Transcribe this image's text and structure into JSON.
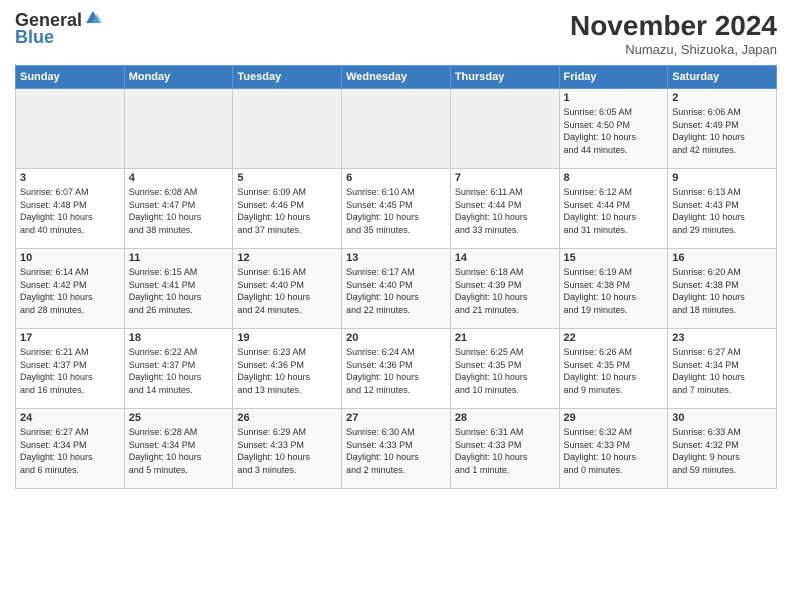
{
  "header": {
    "logo_general": "General",
    "logo_blue": "Blue",
    "title": "November 2024",
    "location": "Numazu, Shizuoka, Japan"
  },
  "weekdays": [
    "Sunday",
    "Monday",
    "Tuesday",
    "Wednesday",
    "Thursday",
    "Friday",
    "Saturday"
  ],
  "weeks": [
    [
      {
        "day": "",
        "info": ""
      },
      {
        "day": "",
        "info": ""
      },
      {
        "day": "",
        "info": ""
      },
      {
        "day": "",
        "info": ""
      },
      {
        "day": "",
        "info": ""
      },
      {
        "day": "1",
        "info": "Sunrise: 6:05 AM\nSunset: 4:50 PM\nDaylight: 10 hours\nand 44 minutes."
      },
      {
        "day": "2",
        "info": "Sunrise: 6:06 AM\nSunset: 4:49 PM\nDaylight: 10 hours\nand 42 minutes."
      }
    ],
    [
      {
        "day": "3",
        "info": "Sunrise: 6:07 AM\nSunset: 4:48 PM\nDaylight: 10 hours\nand 40 minutes."
      },
      {
        "day": "4",
        "info": "Sunrise: 6:08 AM\nSunset: 4:47 PM\nDaylight: 10 hours\nand 38 minutes."
      },
      {
        "day": "5",
        "info": "Sunrise: 6:09 AM\nSunset: 4:46 PM\nDaylight: 10 hours\nand 37 minutes."
      },
      {
        "day": "6",
        "info": "Sunrise: 6:10 AM\nSunset: 4:45 PM\nDaylight: 10 hours\nand 35 minutes."
      },
      {
        "day": "7",
        "info": "Sunrise: 6:11 AM\nSunset: 4:44 PM\nDaylight: 10 hours\nand 33 minutes."
      },
      {
        "day": "8",
        "info": "Sunrise: 6:12 AM\nSunset: 4:44 PM\nDaylight: 10 hours\nand 31 minutes."
      },
      {
        "day": "9",
        "info": "Sunrise: 6:13 AM\nSunset: 4:43 PM\nDaylight: 10 hours\nand 29 minutes."
      }
    ],
    [
      {
        "day": "10",
        "info": "Sunrise: 6:14 AM\nSunset: 4:42 PM\nDaylight: 10 hours\nand 28 minutes."
      },
      {
        "day": "11",
        "info": "Sunrise: 6:15 AM\nSunset: 4:41 PM\nDaylight: 10 hours\nand 26 minutes."
      },
      {
        "day": "12",
        "info": "Sunrise: 6:16 AM\nSunset: 4:40 PM\nDaylight: 10 hours\nand 24 minutes."
      },
      {
        "day": "13",
        "info": "Sunrise: 6:17 AM\nSunset: 4:40 PM\nDaylight: 10 hours\nand 22 minutes."
      },
      {
        "day": "14",
        "info": "Sunrise: 6:18 AM\nSunset: 4:39 PM\nDaylight: 10 hours\nand 21 minutes."
      },
      {
        "day": "15",
        "info": "Sunrise: 6:19 AM\nSunset: 4:38 PM\nDaylight: 10 hours\nand 19 minutes."
      },
      {
        "day": "16",
        "info": "Sunrise: 6:20 AM\nSunset: 4:38 PM\nDaylight: 10 hours\nand 18 minutes."
      }
    ],
    [
      {
        "day": "17",
        "info": "Sunrise: 6:21 AM\nSunset: 4:37 PM\nDaylight: 10 hours\nand 16 minutes."
      },
      {
        "day": "18",
        "info": "Sunrise: 6:22 AM\nSunset: 4:37 PM\nDaylight: 10 hours\nand 14 minutes."
      },
      {
        "day": "19",
        "info": "Sunrise: 6:23 AM\nSunset: 4:36 PM\nDaylight: 10 hours\nand 13 minutes."
      },
      {
        "day": "20",
        "info": "Sunrise: 6:24 AM\nSunset: 4:36 PM\nDaylight: 10 hours\nand 12 minutes."
      },
      {
        "day": "21",
        "info": "Sunrise: 6:25 AM\nSunset: 4:35 PM\nDaylight: 10 hours\nand 10 minutes."
      },
      {
        "day": "22",
        "info": "Sunrise: 6:26 AM\nSunset: 4:35 PM\nDaylight: 10 hours\nand 9 minutes."
      },
      {
        "day": "23",
        "info": "Sunrise: 6:27 AM\nSunset: 4:34 PM\nDaylight: 10 hours\nand 7 minutes."
      }
    ],
    [
      {
        "day": "24",
        "info": "Sunrise: 6:27 AM\nSunset: 4:34 PM\nDaylight: 10 hours\nand 6 minutes."
      },
      {
        "day": "25",
        "info": "Sunrise: 6:28 AM\nSunset: 4:34 PM\nDaylight: 10 hours\nand 5 minutes."
      },
      {
        "day": "26",
        "info": "Sunrise: 6:29 AM\nSunset: 4:33 PM\nDaylight: 10 hours\nand 3 minutes."
      },
      {
        "day": "27",
        "info": "Sunrise: 6:30 AM\nSunset: 4:33 PM\nDaylight: 10 hours\nand 2 minutes."
      },
      {
        "day": "28",
        "info": "Sunrise: 6:31 AM\nSunset: 4:33 PM\nDaylight: 10 hours\nand 1 minute."
      },
      {
        "day": "29",
        "info": "Sunrise: 6:32 AM\nSunset: 4:33 PM\nDaylight: 10 hours\nand 0 minutes."
      },
      {
        "day": "30",
        "info": "Sunrise: 6:33 AM\nSunset: 4:32 PM\nDaylight: 9 hours\nand 59 minutes."
      }
    ]
  ]
}
